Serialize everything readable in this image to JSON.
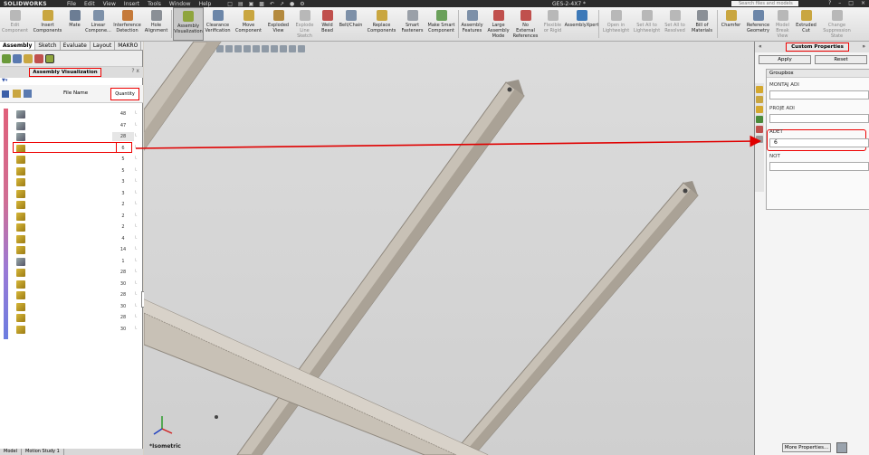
{
  "app": {
    "logo": "SOLIDWORKS",
    "document": "GES-2-4X7 *"
  },
  "menu": [
    "File",
    "Edit",
    "View",
    "Insert",
    "Tools",
    "Window",
    "Help"
  ],
  "search": {
    "placeholder": "Search files and models"
  },
  "ribbon": [
    {
      "id": "edit-component",
      "label": "Edit\nComponent",
      "icon": "edit-component-icon",
      "color": "#b8b8b8",
      "disabled": true
    },
    {
      "id": "insert-components",
      "label": "Insert\nComponents",
      "icon": "insert-components-icon",
      "color": "#c9a640"
    },
    {
      "id": "mate",
      "label": "Mate",
      "icon": "mate-icon",
      "color": "#6c7d94"
    },
    {
      "id": "linear-component",
      "label": "Linear\nCompone...",
      "icon": "linear-pattern-icon",
      "color": "#7d90a8"
    },
    {
      "id": "interference-detection",
      "label": "Interference\nDetection",
      "icon": "interference-icon",
      "color": "#c57a3a"
    },
    {
      "id": "hole-alignment",
      "label": "Hole\nAlignment",
      "icon": "hole-alignment-icon",
      "color": "#8a8f96"
    },
    {
      "id": "assembly-visualization",
      "label": "Assembly\nVisualization",
      "icon": "assembly-visualization-icon",
      "color": "#8fa53d",
      "active": true
    },
    {
      "id": "clearance-verification",
      "label": "Clearance\nVerification",
      "icon": "clearance-icon",
      "color": "#6c86a8"
    },
    {
      "id": "move-component",
      "label": "Move\nComponent",
      "icon": "move-component-icon",
      "color": "#c9a640"
    },
    {
      "id": "exploded-view",
      "label": "Exploded\nView",
      "icon": "exploded-view-icon",
      "color": "#b48a3e"
    },
    {
      "id": "explode-line-sketch",
      "label": "Explode\nLine\nSketch",
      "icon": "explode-line-icon",
      "color": "#b8b8b8",
      "disabled": true
    },
    {
      "id": "weld-bead",
      "label": "Weld\nBead",
      "icon": "weld-bead-icon",
      "color": "#c0504d"
    },
    {
      "id": "belt-chain",
      "label": "Belt/Chain",
      "icon": "belt-chain-icon",
      "color": "#7d90a8"
    },
    {
      "id": "replace-components",
      "label": "Replace\nComponents",
      "icon": "replace-components-icon",
      "color": "#c9a640"
    },
    {
      "id": "smart-fasteners",
      "label": "Smart\nFasteners",
      "icon": "smart-fasteners-icon",
      "color": "#9aa0a8"
    },
    {
      "id": "make-smart-component",
      "label": "Make Smart\nComponent",
      "icon": "smart-component-icon",
      "color": "#6aa05a"
    },
    {
      "id": "assembly-features",
      "label": "Assembly\nFeatures",
      "icon": "assembly-features-icon",
      "color": "#7d90a8"
    },
    {
      "id": "large-assembly-mode",
      "label": "Large\nAssembly\nMode",
      "icon": "large-assembly-icon",
      "color": "#c0504d"
    },
    {
      "id": "no-external-references",
      "label": "No\nExternal\nReferences",
      "icon": "no-external-ref-icon",
      "color": "#c0504d"
    },
    {
      "id": "flexible-or-rigid",
      "label": "Flexible\nor Rigid",
      "icon": "flexible-rigid-icon",
      "color": "#b8b8b8",
      "disabled": true
    },
    {
      "id": "assemblyxpert",
      "label": "AssemblyXpert",
      "icon": "assemblyxpert-icon",
      "color": "#3d79b8"
    },
    {
      "id": "open-in-lightweight",
      "label": "Open in\nLightweight",
      "icon": "lightweight-icon",
      "color": "#b8b8b8",
      "disabled": true
    },
    {
      "id": "set-all-to-lightweight",
      "label": "Set All to\nLightweight",
      "icon": "set-lightweight-icon",
      "color": "#b8b8b8",
      "disabled": true
    },
    {
      "id": "set-all-to-resolved",
      "label": "Set All to\nResolved",
      "icon": "set-resolved-icon",
      "color": "#b8b8b8",
      "disabled": true
    },
    {
      "id": "bill-of-materials",
      "label": "Bill of\nMaterials",
      "icon": "bom-icon",
      "color": "#8a8f96"
    },
    {
      "id": "chamfer",
      "label": "Chamfer",
      "icon": "chamfer-icon",
      "color": "#c9a640"
    },
    {
      "id": "reference-geometry",
      "label": "Reference\nGeometry",
      "icon": "reference-geometry-icon",
      "color": "#6c86a8"
    },
    {
      "id": "model-break-view",
      "label": "Model\nBreak\nView",
      "icon": "break-view-icon",
      "color": "#b8b8b8",
      "disabled": true
    },
    {
      "id": "extruded-cut",
      "label": "Extruded\nCut",
      "icon": "extruded-cut-icon",
      "color": "#c9a640"
    },
    {
      "id": "change-suppression-state",
      "label": "Change\nSuppression\nState",
      "icon": "suppression-icon",
      "color": "#b8b8b8",
      "disabled": true
    }
  ],
  "left_tabs": [
    "Assembly",
    "Sketch",
    "Evaluate",
    "Layout",
    "MAKRO"
  ],
  "assembly_visualization": {
    "title": "Assembly Visualization",
    "help": "? x",
    "filter": "▾",
    "col_file": "File Name",
    "col_qty": "Quantity",
    "rows": [
      {
        "qty": "48",
        "icon": "grey"
      },
      {
        "qty": "47",
        "icon": "grey"
      },
      {
        "qty": "28",
        "icon": "grey",
        "shade": true
      },
      {
        "qty": "6",
        "icon": "gold"
      },
      {
        "qty": "5",
        "icon": "gold"
      },
      {
        "qty": "5",
        "icon": "gold"
      },
      {
        "qty": "3",
        "icon": "gold"
      },
      {
        "qty": "3",
        "icon": "gold"
      },
      {
        "qty": "2",
        "icon": "gold"
      },
      {
        "qty": "2",
        "icon": "gold"
      },
      {
        "qty": "2",
        "icon": "gold"
      },
      {
        "qty": "4",
        "icon": "gold"
      },
      {
        "qty": "14",
        "icon": "gold"
      },
      {
        "qty": "1",
        "icon": "grey"
      },
      {
        "qty": "28",
        "icon": "gold"
      },
      {
        "qty": "30",
        "icon": "gold"
      },
      {
        "qty": "28",
        "icon": "gold"
      },
      {
        "qty": "30",
        "icon": "gold"
      },
      {
        "qty": "28",
        "icon": "gold"
      },
      {
        "qty": "30",
        "icon": "gold"
      }
    ]
  },
  "bottom_tabs": [
    "Model",
    "Motion Study 1"
  ],
  "viewport": {
    "view_label": "*Isometric"
  },
  "custom_properties": {
    "title": "Custom Properties",
    "apply_label": "Apply",
    "reset_label": "Reset",
    "groupbox_title": "Groupbox",
    "fields": [
      {
        "label": "MONTAJ ADI",
        "value": ""
      },
      {
        "label": "PROJE ADI",
        "value": ""
      },
      {
        "label": "ADET",
        "value": "6"
      },
      {
        "label": "NOT",
        "value": ""
      }
    ],
    "more_label": "More Properties..."
  },
  "colors": {
    "highlight": "#e00000",
    "beam": "#c8c1b6",
    "beam_dark": "#8f887e"
  }
}
